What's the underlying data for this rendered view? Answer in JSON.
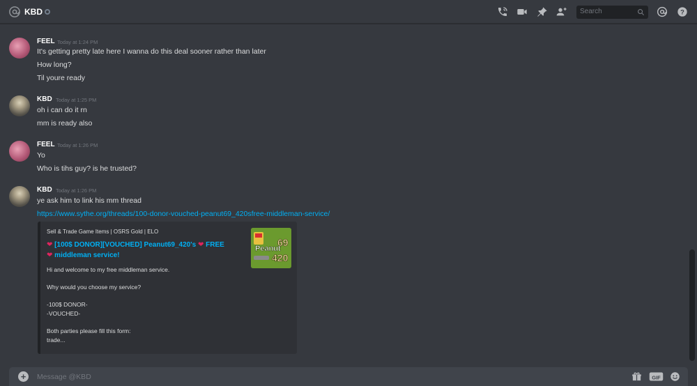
{
  "header": {
    "name": "KBD",
    "search_placeholder": "Search"
  },
  "messages": [
    {
      "author": "FEEL",
      "timestamp": "Today at 1:24 PM",
      "lines": [
        "It's getting pretty late here I wanna do this deal sooner rather than later",
        "How long?",
        "Til youre ready"
      ]
    },
    {
      "author": "KBD",
      "timestamp": "Today at 1:25 PM",
      "lines": [
        "oh i can do it rn",
        "mm is ready also"
      ]
    },
    {
      "author": "FEEL",
      "timestamp": "Today at 1:26 PM",
      "lines": [
        "Yo",
        "Who is tihs guy? is he trusted?"
      ]
    },
    {
      "author": "KBD",
      "timestamp": "Today at 1:26 PM",
      "lines": [
        "ye ask him to link his mm thread"
      ],
      "link": "https://www.sythe.org/threads/100-donor-vouched-peanut69_420sfree-middleman-service/"
    }
  ],
  "embed": {
    "provider": "Sell & Trade Game Items | OSRS Gold | ELO",
    "title_line1": "[100$ DONOR][VOUCHED] Peanut69_420's",
    "title_free": "FREE",
    "title_line2": "middleman service!",
    "desc": [
      "Hi and welcome to my free middleman service.",
      "Why would you choose my service?",
      "-100$ DONOR-",
      "-VOUCHED-",
      "Both parties please fill this form:",
      "trade..."
    ],
    "thumb_text_top": "Peanut",
    "thumb_text_num": "69",
    "thumb_text_bottom": "420"
  },
  "input": {
    "placeholder": "Message @KBD",
    "gif_label": "GIF"
  },
  "colors": {
    "background": "#36393f",
    "link": "#00b0f4",
    "heart": "#e0245e"
  }
}
